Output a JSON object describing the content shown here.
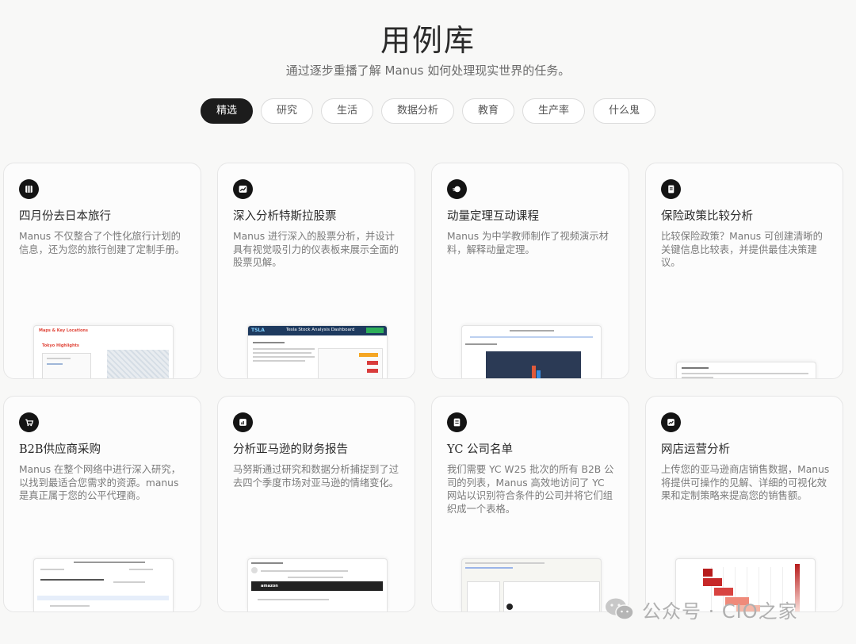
{
  "header": {
    "title": "用例库",
    "subtitle": "通过逐步重播了解 Manus 如何处理现实世界的任务。"
  },
  "tabs": [
    {
      "label": "精选",
      "active": true
    },
    {
      "label": "研究",
      "active": false
    },
    {
      "label": "生活",
      "active": false
    },
    {
      "label": "数据分析",
      "active": false
    },
    {
      "label": "教育",
      "active": false
    },
    {
      "label": "生产率",
      "active": false
    },
    {
      "label": "什么鬼",
      "active": false
    }
  ],
  "cards": [
    {
      "icon": "map-icon",
      "title": "四月份去日本旅行",
      "desc": "Manus 不仅整合了个性化旅行计划的信息，还为您的旅行创建了定制手册。",
      "preview": {
        "heading": "Maps & Key Locations",
        "sub": "Tokyo Highlights",
        "accent": "#e0463a"
      }
    },
    {
      "icon": "chart-icon",
      "title": "深入分析特斯拉股票",
      "desc": "Manus 进行深入的股票分析，并设计具有视觉吸引力的仪表板来展示全面的股票见解。",
      "preview": {
        "heading": "TSLA",
        "sub": "Tesla Stock Analysis Dashboard",
        "accent": "#1e3a5f"
      }
    },
    {
      "icon": "rocket-icon",
      "title": "动量定理互动课程",
      "desc": "Manus 为中学教师制作了视频演示材料，解释动量定理。",
      "preview": {
        "heading": "",
        "sub": "",
        "accent": "#2b3a55"
      }
    },
    {
      "icon": "document-icon",
      "title": "保险政策比较分析",
      "desc": "比较保险政策？Manus 可创建清晰的关键信息比较表，并提供最佳决策建议。",
      "preview": {
        "heading": "",
        "sub": "",
        "accent": "#888888"
      }
    },
    {
      "icon": "cart-icon",
      "title": "B2B供应商采购",
      "desc": "Manus 在整个网络中进行深入研究，以找到最适合您需求的资源。manus 是真正属于您的公平代理商。",
      "preview": {
        "heading": "",
        "sub": "",
        "accent": "#888888"
      }
    },
    {
      "icon": "report-icon",
      "title": "分析亚马逊的财务报告",
      "desc": "马努斯通过研究和数据分析捕捉到了过去四个季度市场对亚马逊的情绪变化。",
      "preview": {
        "heading": "",
        "sub": "amazon",
        "accent": "#222222"
      }
    },
    {
      "icon": "list-icon",
      "title": "YC 公司名单",
      "desc": "我们需要 YC W25 批次的所有 B2B 公司的列表，Manus 高效地访问了 YC 网站以识别符合条件的公司并将它们组织成一个表格。",
      "preview": {
        "heading": "",
        "sub": "",
        "accent": "#3b6bd8"
      }
    },
    {
      "icon": "analytics-icon",
      "title": "网店运营分析",
      "desc": "上传您的亚马逊商店销售数据，Manus 将提供可操作的见解、详细的可视化效果和定制策略来提高您的销售额。",
      "preview": {
        "heading": "",
        "sub": "",
        "accent": "#c62828"
      }
    }
  ],
  "watermark": {
    "text": "公众号 · CIO之家",
    "icon": "wechat-icon"
  }
}
